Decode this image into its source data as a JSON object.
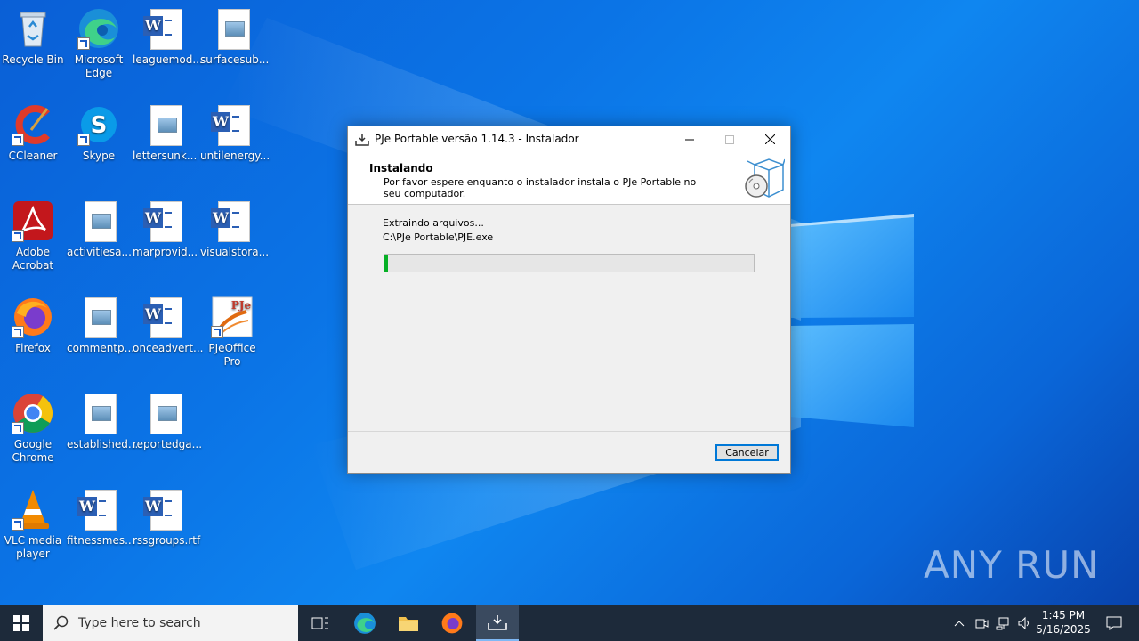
{
  "desktop": {
    "icons": [
      {
        "label": "Recycle Bin"
      },
      {
        "label": "Microsoft Edge"
      },
      {
        "label": "leaguemod..."
      },
      {
        "label": "surfacesub..."
      },
      {
        "label": "CCleaner"
      },
      {
        "label": "Skype"
      },
      {
        "label": "lettersunk..."
      },
      {
        "label": "untilenergy..."
      },
      {
        "label": "Adobe Acrobat"
      },
      {
        "label": "activitiesa..."
      },
      {
        "label": "marprovid..."
      },
      {
        "label": "visualstora..."
      },
      {
        "label": "Firefox"
      },
      {
        "label": "commentp..."
      },
      {
        "label": "onceadvert..."
      },
      {
        "label": "PJeOffice Pro"
      },
      {
        "label": "Google Chrome"
      },
      {
        "label": "established..."
      },
      {
        "label": "reportedga..."
      },
      {
        "label": "VLC media player"
      },
      {
        "label": "fitnessmes..."
      },
      {
        "label": "rssgroups.rtf"
      }
    ],
    "watermark": "ANY RUN"
  },
  "installer": {
    "title": "PJe Portable versão 1.14.3 - Instalador",
    "header_title": "Instalando",
    "header_desc": "Por favor espere enquanto o instalador instala o PJe Portable no seu computador.",
    "status": "Extraindo arquivos...",
    "path": "C:\\PJe Portable\\PJE.exe",
    "progress_fraction": 0.01,
    "cancel_label": "Cancelar"
  },
  "taskbar": {
    "search_placeholder": "Type here to search",
    "time": "1:45 PM",
    "date": "5/16/2025"
  },
  "colors": {
    "progress_fill": "#06b025",
    "accent": "#0078d7",
    "taskbar": "#1d2a3a"
  }
}
